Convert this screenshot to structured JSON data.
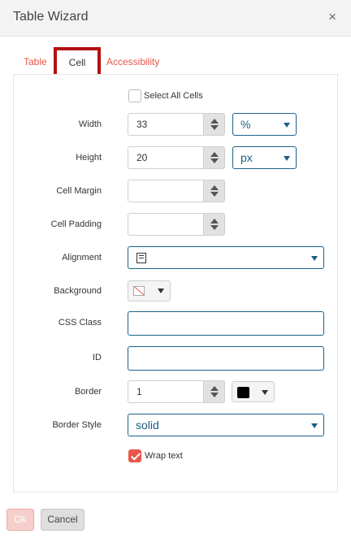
{
  "dialog": {
    "title": "Table Wizard",
    "close_glyph": "×"
  },
  "tabs": [
    {
      "label": "Table"
    },
    {
      "label": "Cell"
    },
    {
      "label": "Accessibility"
    }
  ],
  "form": {
    "select_all": {
      "label": "Select All Cells",
      "checked": false
    },
    "width": {
      "label": "Width",
      "value": "33",
      "unit": "%"
    },
    "height": {
      "label": "Height",
      "value": "20",
      "unit": "px"
    },
    "cell_margin": {
      "label": "Cell Margin",
      "value": ""
    },
    "cell_padding": {
      "label": "Cell Padding",
      "value": ""
    },
    "alignment": {
      "label": "Alignment",
      "icon": "align-left-icon"
    },
    "background": {
      "label": "Background",
      "swatch": "no-color"
    },
    "css_class": {
      "label": "CSS Class",
      "value": ""
    },
    "id": {
      "label": "ID",
      "value": ""
    },
    "border": {
      "label": "Border",
      "value": "1",
      "color": "#000000"
    },
    "border_style": {
      "label": "Border Style",
      "value": "solid"
    },
    "wrap_text": {
      "label": "Wrap text",
      "checked": true
    }
  },
  "footer": {
    "ok_label": "Ok",
    "cancel_label": "Cancel"
  },
  "colors": {
    "accent": "#e8574a",
    "select_border": "#1b6289",
    "active_tab_border": "#b30f14"
  }
}
